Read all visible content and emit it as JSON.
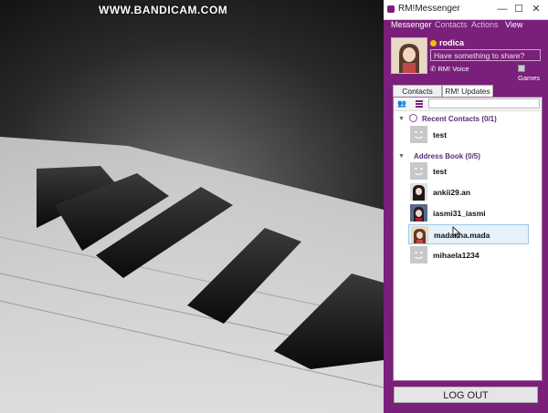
{
  "watermark": "WWW.BANDICAM.COM",
  "window": {
    "title": "RM!Messenger"
  },
  "menu": [
    "Messenger",
    "Contacts",
    "Actions",
    "View"
  ],
  "profile": {
    "username": "rodica",
    "share_placeholder": "Have something to share?",
    "voice_label": "RM! Voice",
    "games_label": "Games"
  },
  "tabs": [
    "Contacts",
    "RM! Updates"
  ],
  "groups": {
    "recent": {
      "title": "Recent Contacts (0/1)",
      "contacts": [
        "test"
      ]
    },
    "address_book": {
      "title": "Address Book (0/5)",
      "contacts": [
        "test",
        "ankii29.an",
        "iasmi31_iasmi",
        "madalina.mada",
        "mihaela1234"
      ]
    }
  },
  "logout_label": "LOG OUT",
  "colors": {
    "accent": "#7a1f7a",
    "status": "#f0c000",
    "selected_bg": "#e5f1fb"
  }
}
